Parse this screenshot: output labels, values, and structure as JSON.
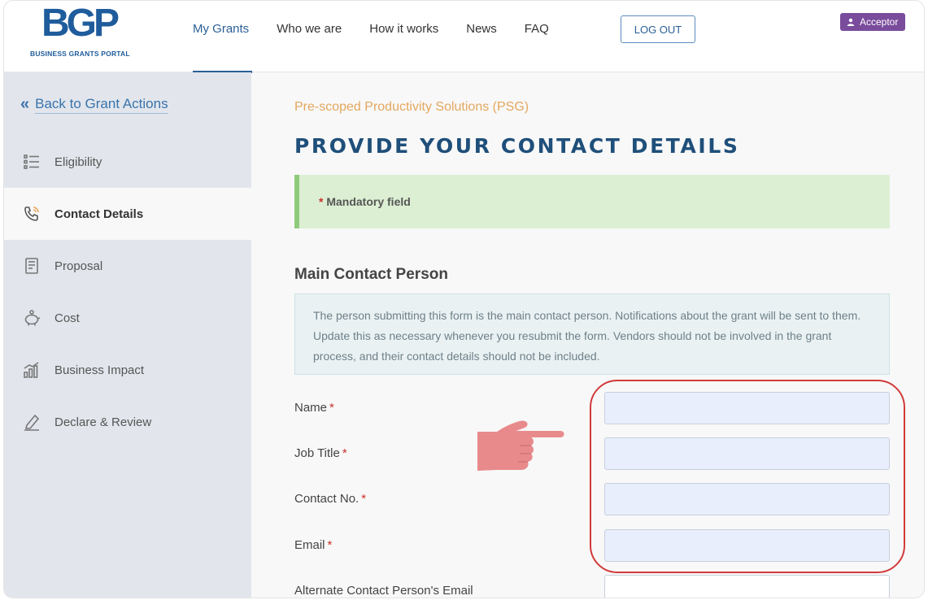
{
  "logo": {
    "mark": "BGP",
    "subtitle": "BUSINESS GRANTS PORTAL"
  },
  "nav": {
    "items": [
      {
        "label": "My Grants",
        "active": true
      },
      {
        "label": "Who we are"
      },
      {
        "label": "How it works"
      },
      {
        "label": "News"
      },
      {
        "label": "FAQ"
      }
    ],
    "logout_label": "LOG OUT",
    "role_label": "Acceptor"
  },
  "sidebar": {
    "back_label": "Back to Grant Actions",
    "items": [
      {
        "label": "Eligibility",
        "icon": "list-icon"
      },
      {
        "label": "Contact Details",
        "icon": "phone-icon",
        "active": true
      },
      {
        "label": "Proposal",
        "icon": "document-icon"
      },
      {
        "label": "Cost",
        "icon": "piggy-bank-icon"
      },
      {
        "label": "Business Impact",
        "icon": "bar-chart-icon"
      },
      {
        "label": "Declare & Review",
        "icon": "pen-icon"
      }
    ]
  },
  "main": {
    "scheme": "Pre-scoped Productivity Solutions (PSG)",
    "title": "PROVIDE YOUR CONTACT DETAILS",
    "mandatory_star": "*",
    "mandatory_text": "Mandatory field",
    "section_title": "Main Contact Person",
    "info_text": "The person submitting this form is the main contact person. Notifications about the grant will be sent to them. Update this as necessary whenever you resubmit the form. Vendors should not be involved in the grant process, and their contact details should not be included.",
    "fields": [
      {
        "label": "Name",
        "required_mark": "*",
        "value": ""
      },
      {
        "label": "Job Title",
        "required_mark": "*",
        "value": ""
      },
      {
        "label": "Contact No.",
        "required_mark": "*",
        "value": ""
      },
      {
        "label": "Email",
        "required_mark": "*",
        "value": ""
      },
      {
        "label": "Alternate Contact Person's Email",
        "value": ""
      }
    ]
  },
  "colors": {
    "brand": "#1f5c9c",
    "scheme_orange": "#e4a760",
    "role_purple": "#7a4c9c",
    "mandatory_green": "#dcefd3",
    "highlight_red": "#d23a3a",
    "pointer_pink": "#e88a8c"
  }
}
